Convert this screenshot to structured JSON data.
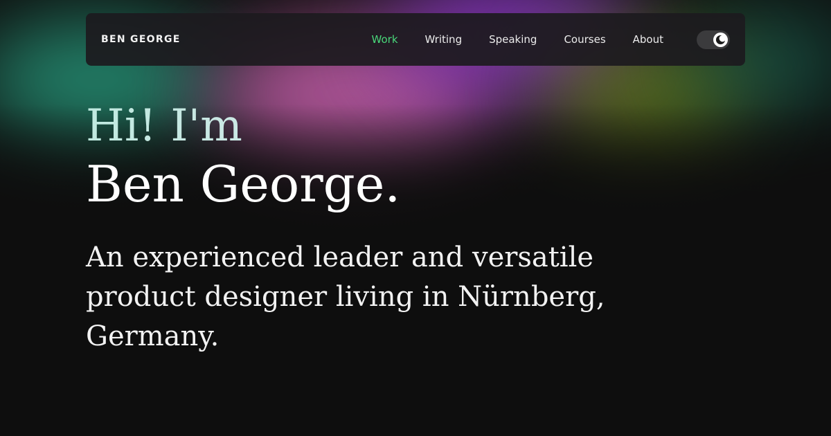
{
  "brand": {
    "name": "BEN GEORGE"
  },
  "nav": {
    "items": [
      {
        "label": "Work",
        "active": true
      },
      {
        "label": "Writing",
        "active": false
      },
      {
        "label": "Speaking",
        "active": false
      },
      {
        "label": "Courses",
        "active": false
      },
      {
        "label": "About",
        "active": false
      }
    ],
    "theme_toggle": {
      "icon": "moon-icon",
      "state": "dark"
    }
  },
  "hero": {
    "greeting": "Hi! I'm",
    "name": "Ben George.",
    "bio": "An experienced leader and versatile product designer living in Nürnberg, Germany."
  },
  "colors": {
    "background": "#0e0e0e",
    "nav_active": "#49d77a",
    "nav_bar": "#1c1a1e",
    "glow_green": "#2bb08e",
    "glow_pink": "#d064b4",
    "glow_purple": "#8d38c8",
    "glow_olive": "#6f8a1e"
  }
}
